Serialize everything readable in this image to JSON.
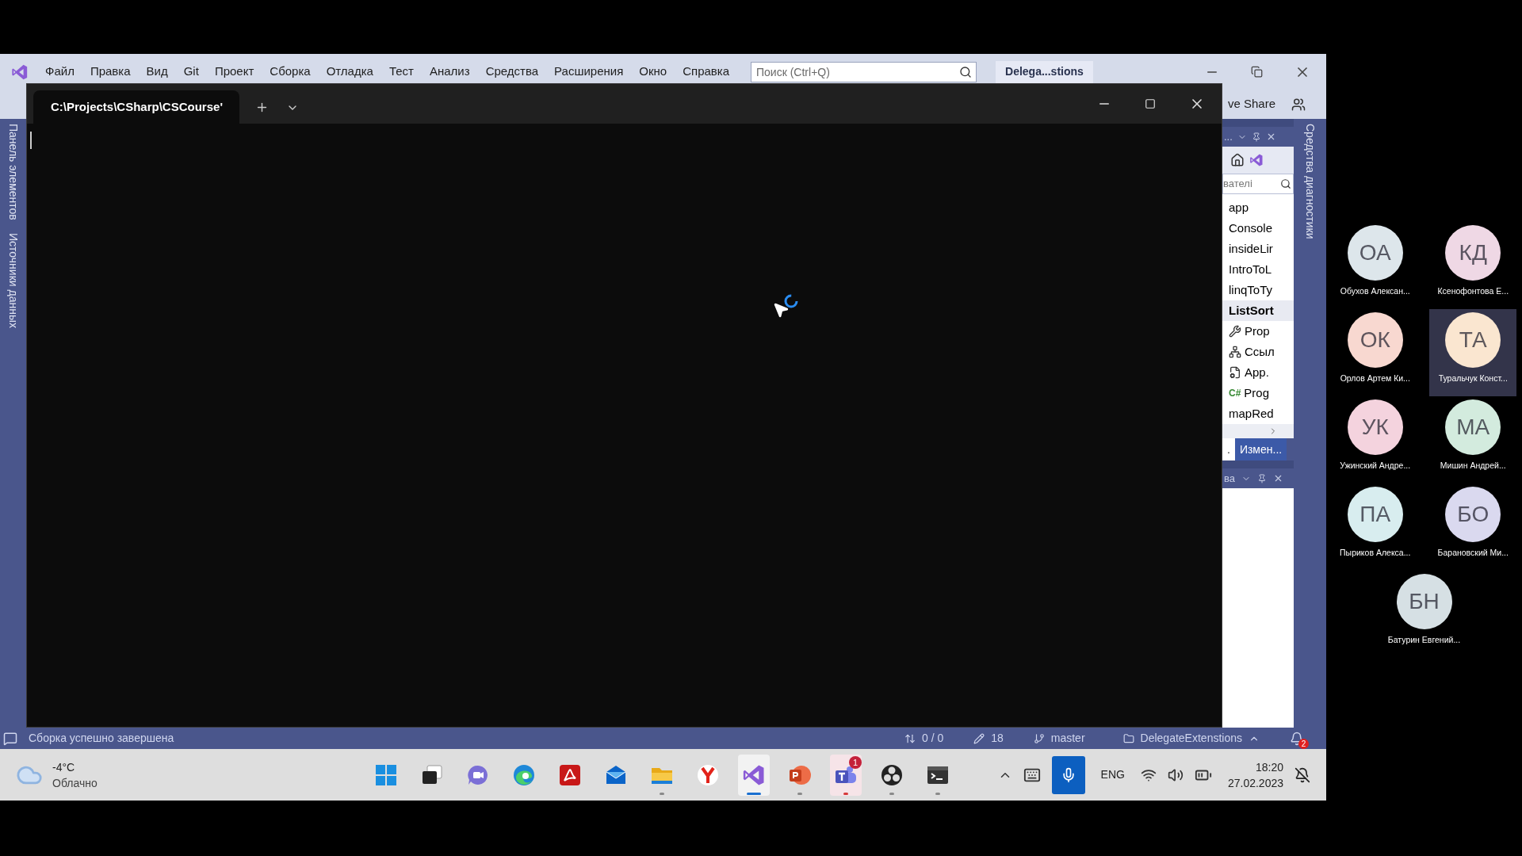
{
  "vs": {
    "menu": [
      "Файл",
      "Правка",
      "Вид",
      "Git",
      "Проект",
      "Сборка",
      "Отладка",
      "Тест",
      "Анализ",
      "Средства",
      "Расширения",
      "Окно",
      "Справка"
    ],
    "search": {
      "placeholder": "Поиск (Ctrl+Q)"
    },
    "solution_name": "Delega...stions",
    "live_share": "ve Share",
    "left_tabs": [
      "Панель элементов",
      "Источники данных"
    ],
    "right_tabs": [
      "Средства диагностики"
    ],
    "explorer": {
      "title": "...",
      "search": "вателі",
      "items": [
        {
          "kind": "project",
          "label": "app",
          "startup": false
        },
        {
          "kind": "project",
          "label": "Console",
          "startup": false
        },
        {
          "kind": "project",
          "label": "insideLir",
          "startup": false
        },
        {
          "kind": "project",
          "label": "IntroToL",
          "startup": false
        },
        {
          "kind": "project",
          "label": "linqToTy",
          "startup": false
        },
        {
          "kind": "project",
          "label": "ListSort",
          "startup": true
        },
        {
          "kind": "properties",
          "label": "Prop",
          "startup": false
        },
        {
          "kind": "references",
          "label": "Ссыл",
          "startup": false
        },
        {
          "kind": "config",
          "label": "App.",
          "startup": false
        },
        {
          "kind": "csharp",
          "badge": "C#",
          "label": "Prog",
          "startup": false
        },
        {
          "kind": "project",
          "label": "mapRed",
          "startup": false
        }
      ],
      "tabs": [
        {
          "label": ".",
          "selected": true
        },
        {
          "label": "Измен...",
          "selected": false
        }
      ]
    },
    "properties_panel": {
      "title": "ва"
    },
    "status_bar": {
      "message": "Сборка успешно завершена",
      "changes": "0 / 0",
      "commits": "18",
      "branch": "master",
      "repo": "DelegateExtenstions",
      "notifications": "2"
    }
  },
  "terminal": {
    "tab_title": "C:\\Projects\\CSharp\\CSCourse'",
    "loading": true
  },
  "taskbar": {
    "weather": {
      "temperature": "-4°C",
      "condition": "Облачно"
    },
    "apps": [
      {
        "kind": "start",
        "running": false,
        "selected": false,
        "attention": false
      },
      {
        "kind": "task-view",
        "running": false,
        "selected": false,
        "attention": false
      },
      {
        "kind": "chat",
        "running": false,
        "selected": false,
        "attention": false
      },
      {
        "kind": "edge",
        "running": false,
        "selected": false,
        "attention": false
      },
      {
        "kind": "acrobat",
        "running": false,
        "selected": false,
        "attention": false
      },
      {
        "kind": "mail",
        "running": false,
        "selected": false,
        "attention": false
      },
      {
        "kind": "explorer",
        "running": true,
        "selected": false,
        "attention": false
      },
      {
        "kind": "yandex",
        "running": false,
        "selected": false,
        "attention": false
      },
      {
        "kind": "visual-studio",
        "running": true,
        "selected": true,
        "attention": false
      },
      {
        "kind": "powerpoint",
        "running": true,
        "selected": false,
        "attention": false
      },
      {
        "kind": "teams",
        "running": true,
        "selected": false,
        "attention": true,
        "badge": "1"
      },
      {
        "kind": "obs",
        "running": true,
        "selected": false,
        "attention": false
      },
      {
        "kind": "terminal",
        "running": true,
        "selected": false,
        "attention": false
      }
    ],
    "language": "ENG",
    "time": "18:20",
    "date": "27.02.2023"
  },
  "participants": [
    {
      "initials": "ОА",
      "name": "Обухов Алексан...",
      "color": "#dde6eb",
      "selected": false
    },
    {
      "initials": "КД",
      "name": "Ксенофонтова Е...",
      "color": "#efd8e5",
      "selected": false
    },
    {
      "initials": "ОК",
      "name": "Орлов Артем Ки...",
      "color": "#f8d8d0",
      "selected": false
    },
    {
      "initials": "ТА",
      "name": "Туральчук Конст...",
      "color": "#fae6d0",
      "selected": true
    },
    {
      "initials": "УК",
      "name": "Ужинский Андре...",
      "color": "#f4d3de",
      "selected": false
    },
    {
      "initials": "МА",
      "name": "Мишин Андрей...",
      "color": "#d3ebde",
      "selected": false
    },
    {
      "initials": "ПА",
      "name": "Пыриков Алекса...",
      "color": "#d8edef",
      "selected": false
    },
    {
      "initials": "БО",
      "name": "Барановский Ми...",
      "color": "#dad9ef",
      "selected": false
    },
    {
      "initials": "БН",
      "name": "Батурин Евгений...",
      "color": "#d6e0e4",
      "selected": false
    }
  ]
}
